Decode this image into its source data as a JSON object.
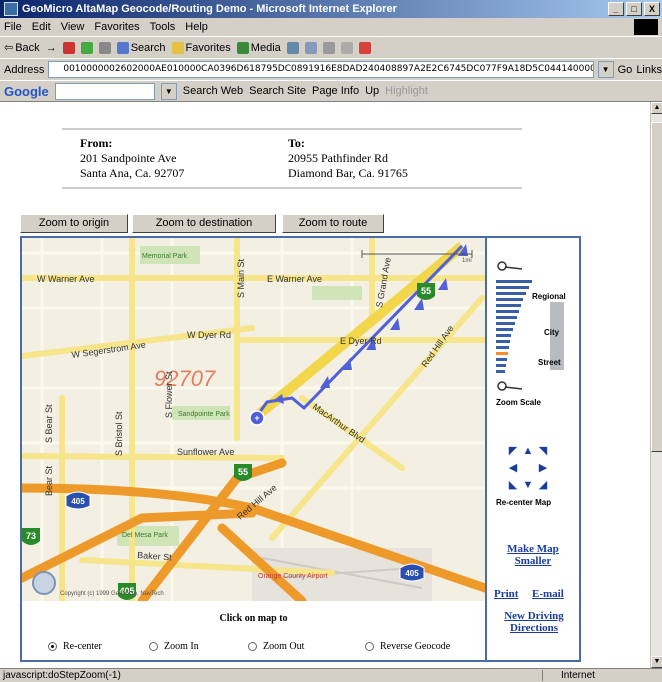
{
  "window": {
    "title": "GeoMicro AltaMap Geocode/Routing Demo - Microsoft Internet Explorer",
    "buttons": [
      "_",
      "□",
      "X"
    ]
  },
  "menu": [
    "File",
    "Edit",
    "View",
    "Favorites",
    "Tools",
    "Help"
  ],
  "toolbar": {
    "back": "Back",
    "forward": "→",
    "search": "Search",
    "favorites": "Favorites",
    "media": "Media"
  },
  "address": {
    "label": "Address",
    "value": "0010000002602000AE010000CA0396D618795DC0891916E8DAD240408897A2E2C6745DC077F9A18D5C04414000000000",
    "go": "Go",
    "links": "Links"
  },
  "google": {
    "logo": "Google",
    "search_web": "Search Web",
    "search_site": "Search Site",
    "page_info": "Page Info",
    "up": "Up",
    "highlight": "Highlight"
  },
  "route": {
    "from_label": "From:",
    "from_line1": "201 Sandpointe Ave",
    "from_line2": "Santa Ana, Ca. 92707",
    "to_label": "To:",
    "to_line1": "20955 Pathfinder Rd",
    "to_line2": "Diamond Bar, Ca. 91765"
  },
  "zoom_buttons": {
    "origin": "Zoom to origin",
    "destination": "Zoom to destination",
    "route": "Zoom to route"
  },
  "map": {
    "labels": {
      "memorial_park": "Memorial Park",
      "w_warner": "W Warner Ave",
      "e_warner": "E Warner Ave",
      "w_segerstrom": "W Segerstrom Ave",
      "w_dyer": "W Dyer Rd",
      "e_dyer": "E Dyer Rd",
      "zip": "92707",
      "sandpointe_park": "Sandpointe Park",
      "sunflower": "Sunflower Ave",
      "del_mesa": "Del Mesa Park",
      "baker": "Baker St",
      "airport": "Orange County Airport",
      "s_main": "S Main St",
      "s_grand": "S Grand Ave",
      "red_hill": "Red Hill Ave",
      "red_hill_lower": "Red Hill Ave",
      "macarthur": "MacArthur Blvd",
      "s_bristol": "S Bristol St",
      "s_flower": "S Flower St",
      "s_bear": "S Bear St",
      "bear_st": "Bear St",
      "copyright": "Copyright (c) 1999 GeoMicro, NavTech",
      "scale": "1mi",
      "shields": [
        "55",
        "55",
        "405",
        "405",
        "73",
        "405"
      ]
    }
  },
  "click_on_map": {
    "title": "Click on map to",
    "options": [
      "Re-center",
      "Zoom In",
      "Zoom Out",
      "Reverse Geocode"
    ],
    "selected": "Re-center"
  },
  "sidebar": {
    "scale_labels": {
      "regional": "Regional",
      "city": "City",
      "street": "Street",
      "zoom_scale": "Zoom Scale"
    },
    "recenter_label": "Re-center Map",
    "make_smaller": "Make Map Smaller",
    "print": "Print",
    "email": "E-mail",
    "new_directions": "New Driving Directions"
  },
  "status": {
    "text": "javascript:doStepZoom(-1)",
    "zone": "Internet"
  },
  "colors": {
    "route": "#5060d8",
    "freeway": "#f0a030",
    "map_bg": "#f3efe2",
    "frame": "#4a6aa8"
  }
}
